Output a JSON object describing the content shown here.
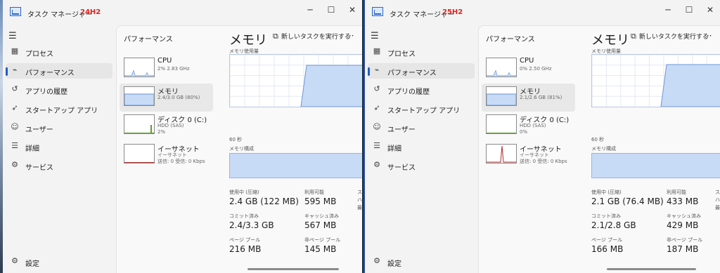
{
  "windows": [
    {
      "app_title": "タスク マネージャー",
      "version_label": "24H2",
      "nav": [
        {
          "label": "プロセス",
          "icon": "processes-icon"
        },
        {
          "label": "パフォーマンス",
          "icon": "performance-icon",
          "selected": true
        },
        {
          "label": "アプリの履歴",
          "icon": "history-icon"
        },
        {
          "label": "スタートアップ アプリ",
          "icon": "startup-icon"
        },
        {
          "label": "ユーザー",
          "icon": "users-icon"
        },
        {
          "label": "詳細",
          "icon": "details-icon"
        },
        {
          "label": "サービス",
          "icon": "services-icon"
        }
      ],
      "settings_label": "設定",
      "page_title": "パフォーマンス",
      "new_task_label": "新しいタスクを実行する",
      "tiles": [
        {
          "name": "CPU",
          "sub": "2%  2.83 GHz",
          "sub2": ""
        },
        {
          "name": "メモリ",
          "sub": "2.4/3.0 GB (80%)",
          "sub2": ""
        },
        {
          "name": "ディスク 0 (C:)",
          "sub": "HDD (SAS)",
          "sub2": "2%"
        },
        {
          "name": "イーサネット",
          "sub": "イーサネット",
          "sub2": "送信: 0 受信: 0 Kbps"
        }
      ],
      "detail": {
        "title": "メモリ",
        "usage_caption": "メモリ使用量",
        "time_caption": "60 秒",
        "composition_caption": "メモリ構成",
        "memory_level": 0.8,
        "stats": [
          {
            "label": "使用中 (圧縮)",
            "value": "2.4 GB (122 MB)"
          },
          {
            "label": "利用可能",
            "value": "595 MB"
          },
          {
            "label": "コミット済み",
            "value": "2.4/3.3 GB"
          },
          {
            "label": "キャッシュ済み",
            "value": "567 MB"
          },
          {
            "label": "ページ プール",
            "value": "216 MB"
          },
          {
            "label": "非ページ プール",
            "value": "145 MB"
          }
        ],
        "right_col": [
          "スロットの",
          "ハードウェ",
          "最大メモリ"
        ]
      }
    },
    {
      "app_title": "タスク マネージャー",
      "version_label": "25H2",
      "nav": [
        {
          "label": "プロセス",
          "icon": "processes-icon"
        },
        {
          "label": "パフォーマンス",
          "icon": "performance-icon",
          "selected": true
        },
        {
          "label": "アプリの履歴",
          "icon": "history-icon"
        },
        {
          "label": "スタートアップ アプリ",
          "icon": "startup-icon"
        },
        {
          "label": "ユーザー",
          "icon": "users-icon"
        },
        {
          "label": "詳細",
          "icon": "details-icon"
        },
        {
          "label": "サービス",
          "icon": "services-icon"
        }
      ],
      "settings_label": "設定",
      "page_title": "パフォーマンス",
      "new_task_label": "新しいタスクを実行する",
      "tiles": [
        {
          "name": "CPU",
          "sub": "0%  2.50 GHz",
          "sub2": ""
        },
        {
          "name": "メモリ",
          "sub": "2.1/2.6 GB (81%)",
          "sub2": ""
        },
        {
          "name": "ディスク 0 (C:)",
          "sub": "HDD (SAS)",
          "sub2": "0%"
        },
        {
          "name": "イーサネット",
          "sub": "イーサネット",
          "sub2": "送信: 0 受信: 0 Kbps"
        }
      ],
      "detail": {
        "title": "メモリ",
        "usage_caption": "メモリ使用量",
        "time_caption": "60 秒",
        "composition_caption": "メモリ構成",
        "memory_level": 0.81,
        "stats": [
          {
            "label": "使用中 (圧縮)",
            "value": "2.1 GB (76.4 MB)"
          },
          {
            "label": "利用可能",
            "value": "433 MB"
          },
          {
            "label": "コミット済み",
            "value": "2.1/2.8 GB"
          },
          {
            "label": "キャッシュ済み",
            "value": "429 MB"
          },
          {
            "label": "ページ プール",
            "value": "166 MB"
          },
          {
            "label": "非ページ プール",
            "value": "187 MB"
          }
        ],
        "right_col": [
          "スロット",
          "ハードウェ",
          "最大メモ"
        ]
      }
    }
  ],
  "colors": {
    "accent": "#1f5fbf",
    "graph_fill": "#c7dbf7",
    "graph_line": "#6e96d4",
    "version": "#e0211d",
    "disk": "#5e9e2e",
    "net": "#b02a2a"
  }
}
